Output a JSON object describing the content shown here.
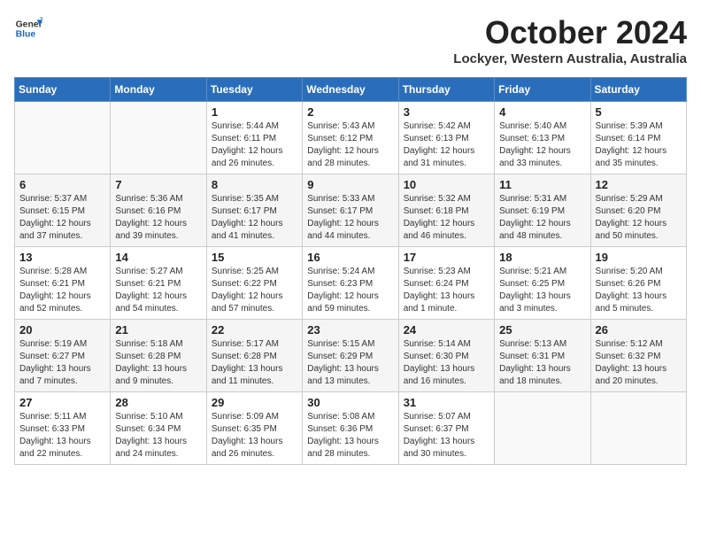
{
  "header": {
    "logo_line1": "General",
    "logo_line2": "Blue",
    "month": "October 2024",
    "location": "Lockyer, Western Australia, Australia"
  },
  "days_of_week": [
    "Sunday",
    "Monday",
    "Tuesday",
    "Wednesday",
    "Thursday",
    "Friday",
    "Saturday"
  ],
  "weeks": [
    [
      {
        "day": "",
        "content": ""
      },
      {
        "day": "",
        "content": ""
      },
      {
        "day": "1",
        "content": "Sunrise: 5:44 AM\nSunset: 6:11 PM\nDaylight: 12 hours and 26 minutes."
      },
      {
        "day": "2",
        "content": "Sunrise: 5:43 AM\nSunset: 6:12 PM\nDaylight: 12 hours and 28 minutes."
      },
      {
        "day": "3",
        "content": "Sunrise: 5:42 AM\nSunset: 6:13 PM\nDaylight: 12 hours and 31 minutes."
      },
      {
        "day": "4",
        "content": "Sunrise: 5:40 AM\nSunset: 6:13 PM\nDaylight: 12 hours and 33 minutes."
      },
      {
        "day": "5",
        "content": "Sunrise: 5:39 AM\nSunset: 6:14 PM\nDaylight: 12 hours and 35 minutes."
      }
    ],
    [
      {
        "day": "6",
        "content": "Sunrise: 5:37 AM\nSunset: 6:15 PM\nDaylight: 12 hours and 37 minutes."
      },
      {
        "day": "7",
        "content": "Sunrise: 5:36 AM\nSunset: 6:16 PM\nDaylight: 12 hours and 39 minutes."
      },
      {
        "day": "8",
        "content": "Sunrise: 5:35 AM\nSunset: 6:17 PM\nDaylight: 12 hours and 41 minutes."
      },
      {
        "day": "9",
        "content": "Sunrise: 5:33 AM\nSunset: 6:17 PM\nDaylight: 12 hours and 44 minutes."
      },
      {
        "day": "10",
        "content": "Sunrise: 5:32 AM\nSunset: 6:18 PM\nDaylight: 12 hours and 46 minutes."
      },
      {
        "day": "11",
        "content": "Sunrise: 5:31 AM\nSunset: 6:19 PM\nDaylight: 12 hours and 48 minutes."
      },
      {
        "day": "12",
        "content": "Sunrise: 5:29 AM\nSunset: 6:20 PM\nDaylight: 12 hours and 50 minutes."
      }
    ],
    [
      {
        "day": "13",
        "content": "Sunrise: 5:28 AM\nSunset: 6:21 PM\nDaylight: 12 hours and 52 minutes."
      },
      {
        "day": "14",
        "content": "Sunrise: 5:27 AM\nSunset: 6:21 PM\nDaylight: 12 hours and 54 minutes."
      },
      {
        "day": "15",
        "content": "Sunrise: 5:25 AM\nSunset: 6:22 PM\nDaylight: 12 hours and 57 minutes."
      },
      {
        "day": "16",
        "content": "Sunrise: 5:24 AM\nSunset: 6:23 PM\nDaylight: 12 hours and 59 minutes."
      },
      {
        "day": "17",
        "content": "Sunrise: 5:23 AM\nSunset: 6:24 PM\nDaylight: 13 hours and 1 minute."
      },
      {
        "day": "18",
        "content": "Sunrise: 5:21 AM\nSunset: 6:25 PM\nDaylight: 13 hours and 3 minutes."
      },
      {
        "day": "19",
        "content": "Sunrise: 5:20 AM\nSunset: 6:26 PM\nDaylight: 13 hours and 5 minutes."
      }
    ],
    [
      {
        "day": "20",
        "content": "Sunrise: 5:19 AM\nSunset: 6:27 PM\nDaylight: 13 hours and 7 minutes."
      },
      {
        "day": "21",
        "content": "Sunrise: 5:18 AM\nSunset: 6:28 PM\nDaylight: 13 hours and 9 minutes."
      },
      {
        "day": "22",
        "content": "Sunrise: 5:17 AM\nSunset: 6:28 PM\nDaylight: 13 hours and 11 minutes."
      },
      {
        "day": "23",
        "content": "Sunrise: 5:15 AM\nSunset: 6:29 PM\nDaylight: 13 hours and 13 minutes."
      },
      {
        "day": "24",
        "content": "Sunrise: 5:14 AM\nSunset: 6:30 PM\nDaylight: 13 hours and 16 minutes."
      },
      {
        "day": "25",
        "content": "Sunrise: 5:13 AM\nSunset: 6:31 PM\nDaylight: 13 hours and 18 minutes."
      },
      {
        "day": "26",
        "content": "Sunrise: 5:12 AM\nSunset: 6:32 PM\nDaylight: 13 hours and 20 minutes."
      }
    ],
    [
      {
        "day": "27",
        "content": "Sunrise: 5:11 AM\nSunset: 6:33 PM\nDaylight: 13 hours and 22 minutes."
      },
      {
        "day": "28",
        "content": "Sunrise: 5:10 AM\nSunset: 6:34 PM\nDaylight: 13 hours and 24 minutes."
      },
      {
        "day": "29",
        "content": "Sunrise: 5:09 AM\nSunset: 6:35 PM\nDaylight: 13 hours and 26 minutes."
      },
      {
        "day": "30",
        "content": "Sunrise: 5:08 AM\nSunset: 6:36 PM\nDaylight: 13 hours and 28 minutes."
      },
      {
        "day": "31",
        "content": "Sunrise: 5:07 AM\nSunset: 6:37 PM\nDaylight: 13 hours and 30 minutes."
      },
      {
        "day": "",
        "content": ""
      },
      {
        "day": "",
        "content": ""
      }
    ]
  ]
}
